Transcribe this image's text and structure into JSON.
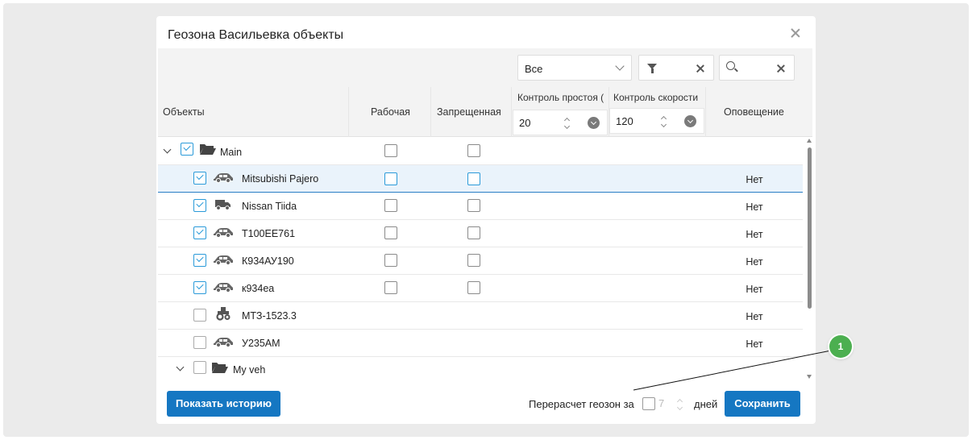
{
  "dialog": {
    "title": "Геозона Васильевка объекты"
  },
  "filters": {
    "status_select": "Все",
    "filter_value": "",
    "search_value": ""
  },
  "columns": {
    "objects": "Объекты",
    "work": "Рабочая",
    "forbidden": "Запрещенная",
    "idle_control": "Контроль простоя (",
    "idle_value": "20",
    "speed_control": "Контроль скорости",
    "speed_value": "120",
    "notification": "Оповещение"
  },
  "rows": [
    {
      "type": "group",
      "name": "Main",
      "icon": "folder-open-icon",
      "checked": true,
      "expanded": true,
      "notification": ""
    },
    {
      "type": "item",
      "name": "Mitsubishi Pajero",
      "icon": "car-icon",
      "checked": true,
      "notification": "Нет",
      "selected": true
    },
    {
      "type": "item",
      "name": "Nissan Tiida",
      "icon": "truck-icon",
      "checked": true,
      "notification": "Нет"
    },
    {
      "type": "item",
      "name": "T100EE761",
      "icon": "car-icon",
      "checked": true,
      "notification": "Нет"
    },
    {
      "type": "item",
      "name": "К934АУ190",
      "icon": "car-icon",
      "checked": true,
      "notification": "Нет"
    },
    {
      "type": "item",
      "name": "к934еа",
      "icon": "car-icon",
      "checked": true,
      "notification": "Нет"
    },
    {
      "type": "item",
      "name": "МТЗ-1523.3",
      "icon": "tractor-icon",
      "checked": false,
      "notification": "Нет"
    },
    {
      "type": "item",
      "name": "У235АМ",
      "icon": "car-icon",
      "checked": false,
      "notification": "Нет"
    },
    {
      "type": "group",
      "name": "My veh",
      "icon": "folder-open-icon",
      "checked": false,
      "expanded": true,
      "notification": ""
    }
  ],
  "footer": {
    "history_button": "Показать историю",
    "recalc_label": "Перерасчет геозон за",
    "recalc_days": "7",
    "days_label": "дней",
    "save_button": "Сохранить"
  },
  "callout": {
    "number": "1",
    "color": "#4caf50"
  },
  "colors": {
    "accent": "#1577c2",
    "checkbox_blue": "#2a9ad9",
    "selected_row": "#eaf3fb"
  }
}
